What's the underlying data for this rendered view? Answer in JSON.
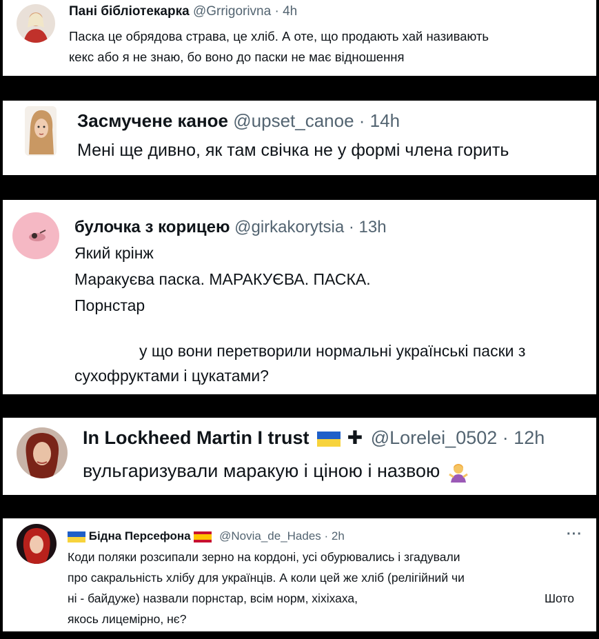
{
  "colors": {
    "background": "#000000",
    "card": "#ffffff",
    "text": "#0f1419",
    "muted": "#536471",
    "flag_blue": "#1f5fc8",
    "flag_yellow": "#f7d33c",
    "spain_red": "#c8102e",
    "spain_yellow": "#ffc400"
  },
  "tweets": [
    {
      "name": "Пані бібліотекарка",
      "handle": "@Grrigorivna",
      "time": "· 4h",
      "lines": [
        "Паска це обрядова страва, це хліб. А оте, що продають хай називають",
        "кекс або я не знаю, бо воно до паски не має відношення"
      ]
    },
    {
      "name": "Засмучене каное",
      "handle": "@upset_canoe",
      "time": "· 14h",
      "lines": [
        "Мені ще дивно, як там свічка не у формі члена горить"
      ]
    },
    {
      "name": "булочка з корицею",
      "handle": "@girkakorytsia",
      "time": "· 13h",
      "lines": [
        "Який крінж",
        "Маракуєва паска. МАРАКУЄВА. ПАСКА.",
        "Порнстар",
        "у що вони перетворили нормальні українські паски з",
        "сухофруктами і цукатами?"
      ]
    },
    {
      "name": "In Lockheed Martin I trust",
      "name_suffix": "✚",
      "handle": "@Lorelei_0502",
      "time": "· 12h",
      "lines": [
        "вульгаризували маракую і ціною і назвою"
      ],
      "emoji": "person-shrugging-emoji"
    },
    {
      "name": "Бідна Персефона",
      "handle": "@Novia_de_Hades",
      "time": "· 2h",
      "more": "···",
      "lines": [
        "Коди поляки розсипали зерно на кордоні, усі обурювались і згадували",
        "про сакральність хлібу для українців. А коли цей же хліб (релігійний чи",
        "ні - байдуже) назвали порнстар, всім норм, хіхіхаха,",
        "Шото",
        "якось лицемірно, нє?"
      ]
    }
  ]
}
